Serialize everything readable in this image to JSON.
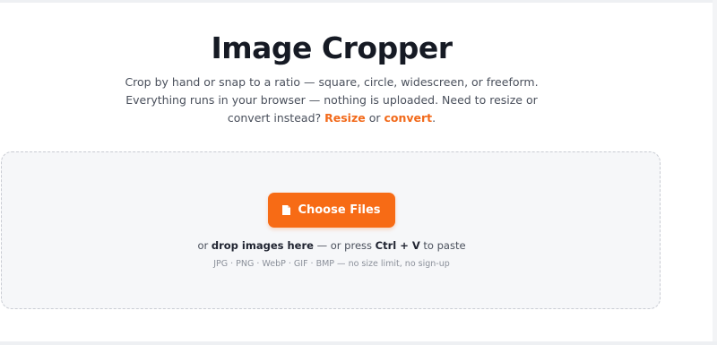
{
  "title": "Image Cropper",
  "subtitle": {
    "text_1": "Crop by hand or snap to a ratio — square, circle, widescreen, or freeform.",
    "text_2": "Everything runs in your browser — nothing is uploaded. Need to resize or",
    "text_3": "convert instead?",
    "link_resize": "Resize",
    "or": "or",
    "link_convert": "convert",
    "period": "."
  },
  "dropzone": {
    "button_label": "Choose Files",
    "button_icon": "file-icon",
    "hint_prefix": "or",
    "hint_drop": "drop images here",
    "hint_middle": "— or press",
    "hint_shortcut": "Ctrl + V",
    "hint_suffix": "to paste",
    "formats": "JPG · PNG · WebP · GIF · BMP — no size limit, no sign-up"
  },
  "colors": {
    "accent": "#f76b15",
    "link": "#f26a1b",
    "dropzone_bg": "#f6f7f9",
    "dropzone_border": "#c9ccd3"
  }
}
